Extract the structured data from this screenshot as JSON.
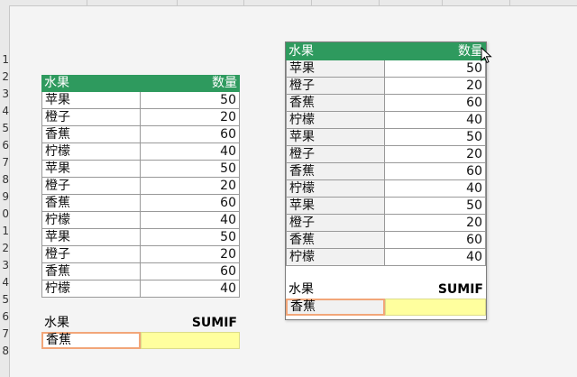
{
  "column_header_visible": "",
  "row_numbers": [
    "1",
    "2",
    "3",
    "4",
    "5",
    "6",
    "7",
    "8",
    "9",
    "0",
    "1",
    "2",
    "3",
    "4",
    "5",
    "6",
    "7",
    "8"
  ],
  "table_left": {
    "header": {
      "fruit": "水果",
      "qty": "数量"
    },
    "rows": [
      {
        "fruit": "苹果",
        "qty": "50"
      },
      {
        "fruit": "橙子",
        "qty": "20"
      },
      {
        "fruit": "香蕉",
        "qty": "60"
      },
      {
        "fruit": "柠檬",
        "qty": "40"
      },
      {
        "fruit": "苹果",
        "qty": "50"
      },
      {
        "fruit": "橙子",
        "qty": "20"
      },
      {
        "fruit": "香蕉",
        "qty": "60"
      },
      {
        "fruit": "柠檬",
        "qty": "40"
      },
      {
        "fruit": "苹果",
        "qty": "50"
      },
      {
        "fruit": "橙子",
        "qty": "20"
      },
      {
        "fruit": "香蕉",
        "qty": "60"
      },
      {
        "fruit": "柠檬",
        "qty": "40"
      }
    ],
    "sumif": {
      "label": "水果",
      "title": "SUMIF",
      "input": "香蕉",
      "result": ""
    }
  },
  "table_right": {
    "header": {
      "fruit": "水果",
      "qty": "数量"
    },
    "rows": [
      {
        "fruit": "苹果",
        "qty": "50"
      },
      {
        "fruit": "橙子",
        "qty": "20"
      },
      {
        "fruit": "香蕉",
        "qty": "60"
      },
      {
        "fruit": "柠檬",
        "qty": "40"
      },
      {
        "fruit": "苹果",
        "qty": "50"
      },
      {
        "fruit": "橙子",
        "qty": "20"
      },
      {
        "fruit": "香蕉",
        "qty": "60"
      },
      {
        "fruit": "柠檬",
        "qty": "40"
      },
      {
        "fruit": "苹果",
        "qty": "50"
      },
      {
        "fruit": "橙子",
        "qty": "20"
      },
      {
        "fruit": "香蕉",
        "qty": "60"
      },
      {
        "fruit": "柠檬",
        "qty": "40"
      }
    ],
    "sumif": {
      "label": "水果",
      "title": "SUMIF",
      "input": "香蕉",
      "result": ""
    }
  },
  "colors": {
    "header_green": "#2e9a5e",
    "result_yellow": "#ffff9e",
    "input_border": "#f2a679"
  },
  "icons": {
    "cursor": "mouse-pointer-icon"
  }
}
